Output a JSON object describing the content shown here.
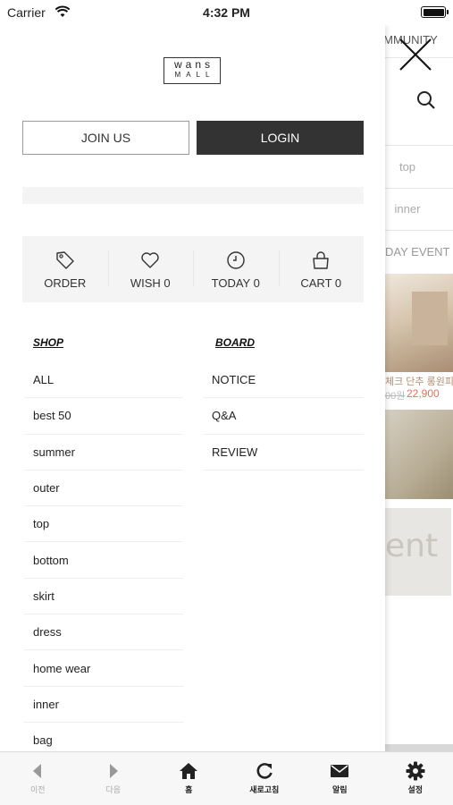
{
  "status_bar": {
    "carrier": "Carrier",
    "time": "4:32 PM"
  },
  "background_page": {
    "community_label": "OMMUNITY",
    "menu_items": [
      "top",
      "inner"
    ],
    "event_label": "DAY EVENT",
    "product_name": "체크 단추 롱원피",
    "old_price": "00원",
    "new_price": "22,900",
    "banner_text": "ent"
  },
  "drawer": {
    "logo": {
      "top": "wans",
      "bottom": "MALL"
    },
    "join_label": "JOIN US",
    "login_label": "LOGIN",
    "quick_menu": [
      {
        "icon": "tag-icon",
        "label": "ORDER"
      },
      {
        "icon": "heart-icon",
        "label": "WISH 0"
      },
      {
        "icon": "clock-icon",
        "label": "TODAY 0"
      },
      {
        "icon": "shopping-bag-icon",
        "label": "CART 0"
      }
    ],
    "shop": {
      "title": "SHOP",
      "items": [
        "ALL",
        "best 50",
        "summer",
        "outer",
        "top",
        "bottom",
        "skirt",
        "dress",
        "home wear",
        "inner",
        "bag"
      ]
    },
    "board": {
      "title": "BOARD",
      "items": [
        "NOTICE",
        "Q&A",
        "REVIEW"
      ]
    }
  },
  "toolbar": {
    "items": [
      {
        "icon": "back-arrow-icon",
        "label": "이전",
        "enabled": false
      },
      {
        "icon": "forward-arrow-icon",
        "label": "다음",
        "enabled": false
      },
      {
        "icon": "home-icon",
        "label": "홈",
        "enabled": true
      },
      {
        "icon": "refresh-icon",
        "label": "새로고침",
        "enabled": true
      },
      {
        "icon": "mail-icon",
        "label": "알림",
        "enabled": true
      },
      {
        "icon": "gear-icon",
        "label": "설정",
        "enabled": true
      }
    ]
  },
  "colors": {
    "login_bg": "#333333",
    "panel_bg": "#f4f4f4",
    "price_accent": "#d9775b",
    "disabled": "#aaaaaa"
  }
}
